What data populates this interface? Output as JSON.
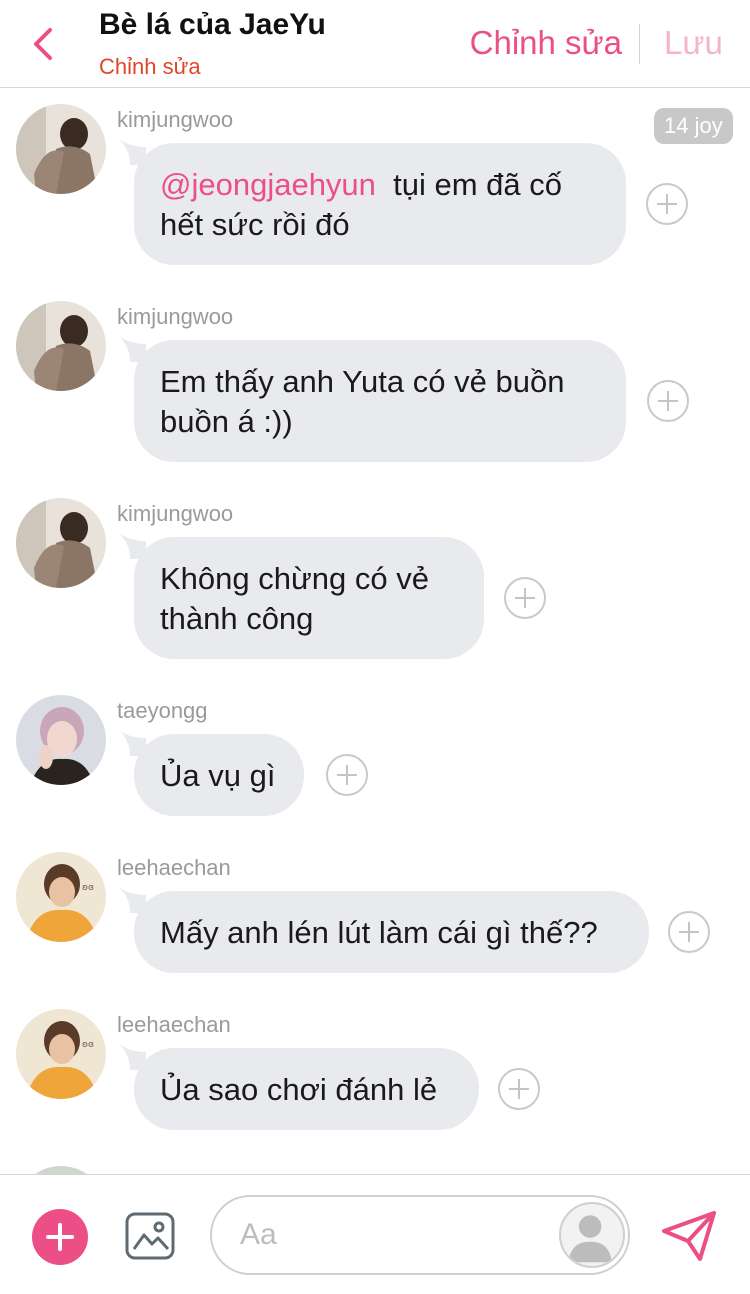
{
  "header": {
    "title": "Bè lá của JaeYu",
    "subtitle": "Chỉnh sửa",
    "edit_label": "Chỉnh sửa",
    "save_label": "Lưu"
  },
  "messages": [
    {
      "username": "kimjungwoo",
      "mention": "@jeongjaehyun",
      "text_line1": "tụi em đã cố",
      "text_line2": "hết sức rồi đó",
      "badge": "14 joy",
      "avatar_icon": "profile-photo"
    },
    {
      "username": "kimjungwoo",
      "text_line1": "Em thấy anh Yuta có vẻ buồn",
      "text_line2": "buồn á :))",
      "avatar_icon": "profile-photo"
    },
    {
      "username": "kimjungwoo",
      "text_line1": "Không chừng có vẻ",
      "text_line2": "thành công",
      "avatar_icon": "profile-photo"
    },
    {
      "username": "taeyongg",
      "text_line1": "Ủa vụ gì",
      "avatar_icon": "profile-photo"
    },
    {
      "username": "leehaechan",
      "text_line1": "Mấy anh lén lút làm cái gì thế??",
      "avatar_icon": "profile-photo"
    },
    {
      "username": "leehaechan",
      "text_line1": "Ủa sao chơi đánh lẻ",
      "avatar_icon": "profile-photo"
    }
  ],
  "composer": {
    "placeholder": "Aa",
    "plus_icon": "plus-icon",
    "image_icon": "image-icon",
    "send_icon": "send-icon"
  },
  "colors": {
    "accent": "#ec4f86",
    "subtitle": "#e2462a",
    "bubble": "#e9eaed",
    "username": "#9a9a9a"
  }
}
